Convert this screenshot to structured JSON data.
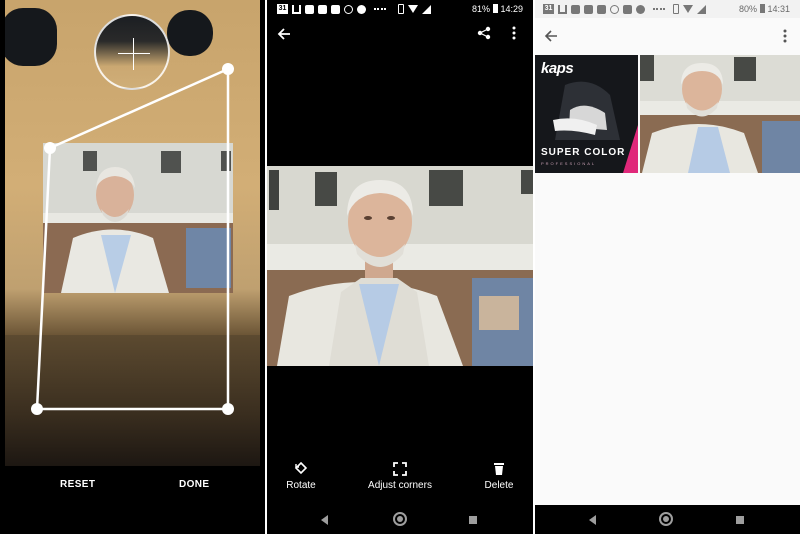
{
  "screens": [
    {
      "id": "crop",
      "buttons": {
        "reset": "RESET",
        "done": "DONE"
      },
      "icons": [
        "magnifier-crosshair-icon"
      ]
    },
    {
      "id": "preview",
      "status": {
        "battery": "81%",
        "time": "14:29",
        "calendar_badge": "31"
      },
      "toolbar": {
        "back_icon": "back-arrow-icon",
        "share_icon": "share-icon",
        "more_icon": "more-vert-icon"
      },
      "actions": [
        {
          "label": "Rotate",
          "icon": "rotate-icon"
        },
        {
          "label": "Adjust corners",
          "icon": "crop-corners-icon"
        },
        {
          "label": "Delete",
          "icon": "trash-icon"
        }
      ]
    },
    {
      "id": "gallery",
      "status": {
        "battery": "80%",
        "time": "14:31",
        "calendar_badge": "31"
      },
      "toolbar": {
        "back_icon": "back-arrow-icon",
        "more_icon": "more-vert-icon"
      },
      "thumbnails": [
        {
          "brand": "kaps",
          "headline": "SUPER COLOR",
          "subline": "PROFESSIONAL"
        },
        {
          "brand": "",
          "headline": "",
          "subline": ""
        }
      ]
    }
  ],
  "colors": {
    "dark_bg": "#000000",
    "light_bg": "#fafafa",
    "accent_pink": "#e0287a"
  }
}
